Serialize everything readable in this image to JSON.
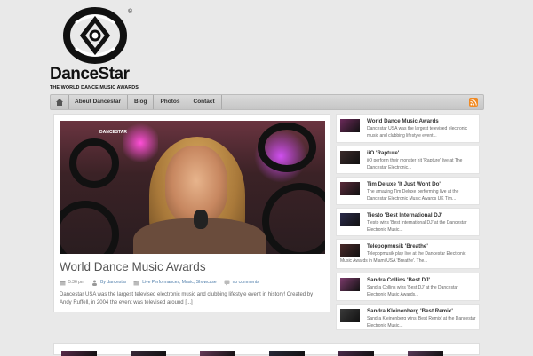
{
  "logo": {
    "brand": "DanceStar",
    "registered": "®",
    "tagline": "THE WORLD DANCE MUSIC AWARDS"
  },
  "nav": {
    "items": [
      {
        "label": "About Dancestar"
      },
      {
        "label": "Blog"
      },
      {
        "label": "Photos"
      },
      {
        "label": "Contact"
      }
    ],
    "icons": {
      "home": "home-icon",
      "rss": "rss-icon"
    }
  },
  "featured": {
    "image_bug": "DANCESTAR",
    "title": "World Dance Music Awards",
    "meta": {
      "time": "5:36 pm",
      "author": "By dancestar",
      "categories": "Live Performances, Music, Showcase",
      "comments": "no comments"
    },
    "excerpt": "Dancestar USA was the largest televised electronic music and clubbing lifestyle event in history! Created by Andy Ruffell, in 2004 the event was televised around [...]"
  },
  "sidebar": {
    "items": [
      {
        "title": "World Dance Music Awards",
        "excerpt": "Dancestar USA was the largest televised electronic music and clubbing lifestyle event...",
        "thumb_color": "#6b2a5a"
      },
      {
        "title": "iiO 'Rapture'",
        "excerpt": "iiO perform their monster hit 'Rapture' live at The Dancestar Electronic...",
        "thumb_color": "#3a2a2a"
      },
      {
        "title": "Tim Deluxe 'It Just Wont Do'",
        "excerpt": "The amazing Tim Deluxe performing live at the Dancestar Electronic Music Awards UK Tim...",
        "thumb_color": "#5a2a3a"
      },
      {
        "title": "Tiesto 'Best International DJ'",
        "excerpt": "Tiesto wins 'Best International DJ' at the Dancestar Electronic Music...",
        "thumb_color": "#2a2a4a"
      },
      {
        "title": "Telepopmusik 'Breathe'",
        "excerpt": "Telepopmusik play live at the Dancestar Electronic Music Awards in Miami USA 'Breathe'. The...",
        "thumb_color": "#4a2a2a"
      },
      {
        "title": "Sandra Collins 'Best DJ'",
        "excerpt": "Sandra Collins wins 'Best DJ' at the Dancestar Electronic Music Awards...",
        "thumb_color": "#7a3a6a"
      },
      {
        "title": "Sandra Kleinenberg 'Best Remix'",
        "excerpt": "Sandra Kleinenberg wins 'Best Remix' at the Dancestar Electronic Music...",
        "thumb_color": "#3a3a3a"
      }
    ]
  },
  "bottom_thumbs": [
    "#5a2a4a",
    "#3a2a3a",
    "#6a3a5a",
    "#2a2a3a",
    "#4a2a4a",
    "#5a3a5a",
    "#3a2a4a"
  ]
}
